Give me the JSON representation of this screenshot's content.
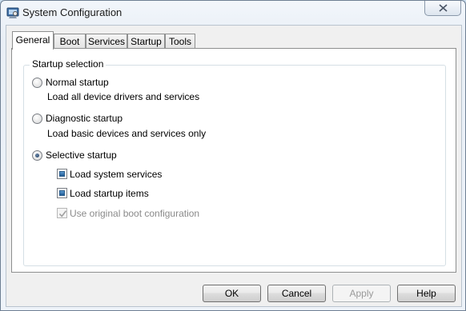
{
  "window": {
    "title": "System Configuration",
    "icon": "system-config-icon"
  },
  "tabs": [
    {
      "label": "General",
      "active": true
    },
    {
      "label": "Boot",
      "active": false
    },
    {
      "label": "Services",
      "active": false
    },
    {
      "label": "Startup",
      "active": false
    },
    {
      "label": "Tools",
      "active": false
    }
  ],
  "startup_selection": {
    "legend": "Startup selection",
    "options": [
      {
        "label": "Normal startup",
        "description": "Load all device drivers and services",
        "selected": false
      },
      {
        "label": "Diagnostic startup",
        "description": "Load basic devices and services only",
        "selected": false
      },
      {
        "label": "Selective startup",
        "description": "",
        "selected": true
      }
    ],
    "selective_items": [
      {
        "label": "Load system services",
        "checked": true,
        "enabled": true
      },
      {
        "label": "Load startup items",
        "checked": true,
        "enabled": true
      },
      {
        "label": "Use original boot configuration",
        "checked": true,
        "enabled": false
      }
    ]
  },
  "buttons": {
    "ok": "OK",
    "cancel": "Cancel",
    "apply": "Apply",
    "help": "Help"
  },
  "colors": {
    "selection_fill": "#1f5b94",
    "disabled_text": "#8a8a8a"
  }
}
